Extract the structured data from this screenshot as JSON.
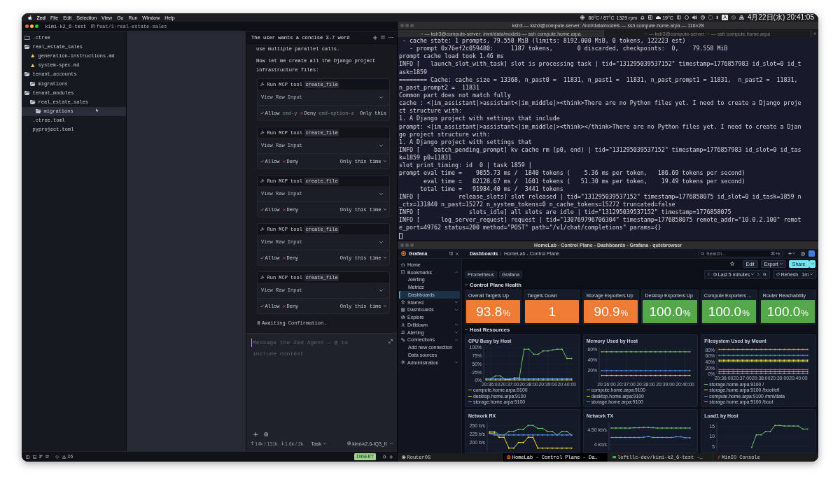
{
  "menu_bar": {
    "app_name": "Zed",
    "menus": [
      "File",
      "Edit",
      "Selection",
      "View",
      "Go",
      "Run",
      "Window",
      "Help"
    ],
    "sensor_readings": [
      "86°C / 87°C",
      "1329 rpm"
    ],
    "weather": "19°C",
    "input_source": "A",
    "clock": "4月22日(水) 20:41:05"
  },
  "zed": {
    "project": "kimi-k2_6-test",
    "branch": "feat/1-real-estate-sales",
    "project_panel": [
      {
        "label": ".ctree",
        "kind": "folder",
        "expanded": false,
        "selected": false
      },
      {
        "label": "real_estate_sales",
        "kind": "folder",
        "expanded": true,
        "selected": false,
        "children": [
          {
            "label": "generation-instructions.md",
            "kind": "doc",
            "selected": false
          },
          {
            "label": "system-spec.md",
            "kind": "doc",
            "selected": false
          }
        ]
      },
      {
        "label": "tenant_accounts",
        "kind": "folder",
        "expanded": true,
        "selected": false,
        "children": [
          {
            "label": "migrations",
            "kind": "folder",
            "expanded": true,
            "selected": false
          }
        ]
      },
      {
        "label": "tenant_modules",
        "kind": "folder",
        "expanded": true,
        "selected": false,
        "children": [
          {
            "label": "real_estate_sales",
            "kind": "folder",
            "expanded": true,
            "selected": false,
            "children": [
              {
                "label": "migrations",
                "kind": "folder",
                "expanded": true,
                "selected": true
              }
            ]
          }
        ]
      },
      {
        "label": ".ctree.toml",
        "kind": "file",
        "selected": false
      },
      {
        "label": "pyproject.toml",
        "kind": "file",
        "selected": false
      }
    ],
    "agent_panel": {
      "thread_title": "The user wants a concise 3-7 word",
      "messages": [
        "use multiple parallel calls.",
        "Now let me create all the Django project infrastructure files:"
      ],
      "tool_calls": [
        {
          "label": "Run MCP tool",
          "tool": "create_file",
          "raw_input": "View Raw Input",
          "allow": "Allow",
          "allow_shortcut": "cmd-y",
          "deny": "Deny",
          "deny_shortcut": "cmd-option-z",
          "scope": "Only this"
        },
        {
          "label": "Run MCP tool",
          "tool": "create_file",
          "raw_input": "View Raw Input",
          "allow": "Allow",
          "deny": "Deny",
          "scope": "Only this time"
        },
        {
          "label": "Run MCP tool",
          "tool": "create_file",
          "raw_input": "View Raw Input",
          "allow": "Allow",
          "deny": "Deny",
          "scope": "Only this time"
        },
        {
          "label": "Run MCP tool",
          "tool": "create_file",
          "raw_input": "View Raw Input",
          "allow": "Allow",
          "deny": "Deny",
          "scope": "Only this time"
        },
        {
          "label": "Run MCP tool",
          "tool": "create_file",
          "raw_input": "View Raw Input",
          "allow": "Allow",
          "deny": "Deny",
          "scope": "Only this time"
        }
      ],
      "status": "Awaiting Confirmation.",
      "input": {
        "placeholder": "Message the Zed Agent — @ to include context"
      },
      "tokens_sent": "14k / 131k",
      "tokens_received": "1.6k / 2k",
      "mode": "Task",
      "model": "kimi-k2.6-IQ3_K"
    },
    "status_bar": {
      "warnings": "36",
      "mode": "INSERT"
    }
  },
  "terminal": {
    "title": "ksh3 — ksh3@compute-server: /mnt/data/models — ssh compute.home.arpa — 116×28",
    "tabs": [
      {
        "label": "~ — ksh3@compute-server: /mnt/data/models — ssh compute.home.arpa",
        "selected": true
      },
      {
        "label": "~ — ksh3@compute-server: ~ — ssh compute.home.arpa",
        "selected": false
      }
    ],
    "lines": [
      " - cache state: 1 prompts, 79.558 MiB (limits: 8192.000 MiB, 0 tokens, 122223 est)",
      "   - prompt 0x76ef2c059480:     1187 tokens,       0 discarded, checkpoints:  0,    79.558 MiB",
      "prompt cache load took 1.46 ms",
      "INFO [   launch_slot_with_task] slot is processing task | tid=\"131295039537152\" timestamp=1776857983 id_slot=0 id_t",
      "ask=1859",
      "======== Cache: cache_size = 13368, n_past0 =  11831, n_past1 =  11831, n_past_prompt1 = 11831,  n_past2 =  11831,",
      "n_past_prompt2 =  11831",
      "Common part does not match fully",
      "cache : <|im_assistant|>assistant<|im_middle|><think>There are no Python files yet. I need to create a Django proje",
      "ct structure with:",
      "1. A Django project with settings that include",
      "prompt: <|im_assistant|>assistant<|im_middle|><think></think>There are no Python files yet. I need to create a Djan",
      "go project structure with:",
      "1. A Django project with settings that",
      "INFO [    batch_pending_prompt] kv cache rm [p0, end) | tid=\"131295039537152\" timestamp=1776857983 id_slot=0 id_tas",
      "k=1859 p0=11831",
      "slot print_timing: id  0 | task 1859 |",
      "prompt eval time =    9855.73 ms /  1840 tokens (    5.36 ms per token,   186.69 tokens per second)",
      "       eval time =   82128.67 ms /  1601 tokens (   51.30 ms per token,    19.49 tokens per second)",
      "      total time =   91984.40 ms /  3441 tokens",
      "INFO [           release_slots] slot released | tid=\"131295039537152\" timestamp=1776858075 id_slot=0 id_task=1859 n",
      "_ctx=131840 n_past=15272 n_system_tokens=0 n_cache_tokens=15272 truncated=false",
      "INFO [              slots_idle] all slots are idle | tid=\"131295039537152\" timestamp=1776858075",
      "INFO [      log_server_request] request | tid=\"130769796706304\" timestamp=1776858075 remote_addr=\"10.0.2.100\" remot",
      "e_port=49762 status=200 method=\"POST\" path=\"/v1/chat/completions\" params={}"
    ]
  },
  "browser": {
    "title": "HomeLab - Control Plane - Dashboards - Grafana - qutebrowser",
    "grafana": {
      "brand": "Grafana",
      "breadcrumbs": [
        "Dashboards",
        "HomeLab - Control Plane"
      ],
      "search": {
        "placeholder": "Search...",
        "shortcut": "⌘+k"
      },
      "nav": [
        {
          "label": "Home",
          "kind": "home",
          "selected": false
        },
        {
          "label": "Bookmarks",
          "kind": "bookmark",
          "selected": false,
          "expanded": true,
          "children": [
            {
              "label": "Alerting",
              "selected": false
            },
            {
              "label": "Metrics",
              "selected": false
            },
            {
              "label": "Dashboards",
              "selected": true
            }
          ]
        },
        {
          "label": "Starred",
          "kind": "star",
          "selected": false,
          "expanded": false
        },
        {
          "label": "Dashboards",
          "kind": "apps",
          "selected": false,
          "expanded": false
        },
        {
          "label": "Explore",
          "kind": "compass",
          "selected": false
        },
        {
          "label": "Drilldown",
          "kind": "drilldown",
          "selected": false,
          "expanded": false
        },
        {
          "label": "Alerting",
          "kind": "bell",
          "selected": false,
          "expanded": false
        },
        {
          "label": "Connections",
          "kind": "link",
          "selected": false,
          "expanded": true,
          "children": [
            {
              "label": "Add new connection",
              "selected": false
            },
            {
              "label": "Data sources",
              "selected": false
            }
          ]
        },
        {
          "label": "Administration",
          "kind": "gear",
          "selected": false,
          "expanded": false
        }
      ],
      "toolbar": {
        "edit": "Edit",
        "export": "Export",
        "share": "Share"
      },
      "links": [
        "Prometheus",
        "Grafana"
      ],
      "time_range": "Last 5 minutes",
      "refresh": "Refresh",
      "refresh_interval": "1m",
      "rows": [
        {
          "title": "Control Plane Health",
          "expanded": true,
          "panels": [
            {
              "kind": "stat",
              "title": "Overall Targets Up",
              "value": "93.8",
              "unit": "%",
              "color": "#ef7b35"
            },
            {
              "kind": "stat",
              "title": "Targets Down",
              "value": "1",
              "color": "#ef7b35"
            },
            {
              "kind": "stat",
              "title": "Storage Exporters Up",
              "value": "90.9",
              "unit": "%",
              "color": "#ef7b35"
            },
            {
              "kind": "stat",
              "title": "Desktop Exporters Up",
              "value": "100.0",
              "unit": "%",
              "color": "#54a84a"
            },
            {
              "kind": "stat",
              "title": "Compute Exporters ...",
              "value": "100.0",
              "unit": "%",
              "color": "#54a84a"
            },
            {
              "kind": "stat",
              "title": "Router Reachability",
              "value": "100.0",
              "unit": "%",
              "color": "#54a84a"
            }
          ]
        },
        {
          "title": "Host Resources",
          "expanded": true,
          "panels": [
            {
              "kind": "timeseries",
              "chart_data": {
                "type": "line",
                "title": "CPU Busy by Host",
                "grid": true,
                "legend": "bottom",
                "categories": [
                  null,
                  "20:36:00",
                  null,
                  null,
                  null,
                  "20:37:00",
                  null,
                  null,
                  null,
                  "20:38:00",
                  null,
                  null,
                  null,
                  "20:39:00",
                  null,
                  null,
                  null,
                  "20:40:00",
                  null
                ],
                "ylim": [
                  0,
                  100
                ],
                "yticks": [
                  {
                    "value": 0,
                    "label": "0%"
                  },
                  {
                    "value": 25,
                    "label": "25%"
                  },
                  {
                    "value": 50,
                    "label": "50%"
                  },
                  {
                    "value": 75,
                    "label": "75%"
                  },
                  {
                    "value": 100,
                    "label": "100%"
                  }
                ],
                "series": [
                  {
                    "name": "compute.home.arpa:9100",
                    "color": "#73bf69",
                    "values": [
                      5,
                      5,
                      14,
                      14,
                      3,
                      3,
                      8,
                      8,
                      95,
                      95,
                      80,
                      80,
                      90,
                      90,
                      93,
                      95,
                      95,
                      67,
                      67
                    ]
                  },
                  {
                    "name": "desktop.home.arpa:9100",
                    "color": "#fade2a",
                    "values": [
                      2,
                      2,
                      2,
                      2,
                      2,
                      2,
                      2,
                      2,
                      2,
                      2,
                      2,
                      2,
                      2,
                      2,
                      2,
                      2,
                      2,
                      2,
                      2
                    ]
                  },
                  {
                    "name": "storage.home.arpa:9100",
                    "color": "#5794f2",
                    "values": [
                      5,
                      5,
                      5,
                      5,
                      5,
                      5,
                      5,
                      5,
                      5,
                      5,
                      5,
                      5,
                      5,
                      5,
                      5,
                      5,
                      5,
                      5,
                      5
                    ]
                  }
                ]
              }
            },
            {
              "kind": "timeseries",
              "chart_data": {
                "type": "line",
                "title": "Memory Used by Host",
                "grid": true,
                "legend": "bottom",
                "categories": [
                  null,
                  "20:36:00",
                  null,
                  null,
                  null,
                  "20:37:00",
                  null,
                  null,
                  null,
                  "20:38:00",
                  null,
                  null,
                  null,
                  "20:39:00",
                  null,
                  null,
                  null,
                  "20:40:00",
                  null
                ],
                "ylim": [
                  0,
                  64
                ],
                "yticks": [
                  {
                    "value": 20,
                    "label": "20%"
                  },
                  {
                    "value": 40,
                    "label": "40%"
                  },
                  {
                    "value": 60,
                    "label": "60%"
                  }
                ],
                "series": [
                  {
                    "name": "compute.home.arpa:9100",
                    "color": "#73bf69",
                    "values": [
                      56,
                      56,
                      56,
                      56,
                      56,
                      56,
                      56,
                      56,
                      56,
                      56,
                      56,
                      56,
                      56,
                      56,
                      56,
                      56,
                      56,
                      56,
                      56
                    ]
                  },
                  {
                    "name": "desktop.home.arpa:9100",
                    "color": "#fade2a",
                    "values": [
                      10,
                      10,
                      10,
                      10,
                      10,
                      10,
                      10,
                      10,
                      10,
                      10,
                      10,
                      10,
                      10,
                      10,
                      10,
                      10,
                      10,
                      10,
                      10
                    ]
                  },
                  {
                    "name": "storage.home.arpa:9100",
                    "color": "#5794f2",
                    "values": [
                      19,
                      19,
                      19,
                      19,
                      19,
                      19,
                      19,
                      19,
                      19,
                      19,
                      19,
                      19,
                      19,
                      19,
                      19,
                      19,
                      19,
                      19,
                      19
                    ]
                  }
                ]
              }
            },
            {
              "kind": "timeseries",
              "chart_data": {
                "type": "line",
                "title": "Filesystem Used by Mount",
                "grid": true,
                "legend": "bottom",
                "categories": [
                  null,
                  "20:36:00",
                  null,
                  null,
                  null,
                  "20:37:00",
                  null,
                  null,
                  null,
                  "20:38:00",
                  null,
                  null,
                  null,
                  "20:39:00",
                  null,
                  null,
                  null,
                  "20:40:00",
                  null,
                  null
                ],
                "ylim": [
                  0,
                  88
                ],
                "yticks": [
                  {
                    "value": 0,
                    "label": "0%"
                  },
                  {
                    "value": 20,
                    "label": "20%"
                  },
                  {
                    "value": 40,
                    "label": "40%"
                  },
                  {
                    "value": 60,
                    "label": "60%"
                  },
                  {
                    "value": 80,
                    "label": "80%"
                  }
                ],
                "series": [
                  {
                    "name": "storage.home.arpa:9100 /",
                    "color": "#73bf69",
                    "values": [
                      42,
                      42,
                      42,
                      42,
                      42,
                      42,
                      42,
                      42,
                      42,
                      42,
                      42,
                      42,
                      42,
                      42,
                      42,
                      42,
                      42,
                      42,
                      42,
                      42
                    ]
                  },
                  {
                    "name": "storage.home.arpa:9100 /boot/efi",
                    "color": "#fade2a",
                    "values": [
                      46,
                      46,
                      46,
                      46,
                      46,
                      46,
                      46,
                      46,
                      46,
                      46,
                      46,
                      46,
                      46,
                      46,
                      46,
                      46,
                      46,
                      46,
                      46,
                      46
                    ]
                  },
                  {
                    "name": "compute.home.arpa:9100 /mnt/data",
                    "color": "#5794f2",
                    "values": [
                      62,
                      62,
                      62,
                      62,
                      62,
                      62,
                      62,
                      62,
                      62,
                      62,
                      62,
                      62,
                      62,
                      62,
                      62,
                      62,
                      62,
                      62,
                      62,
                      62
                    ]
                  },
                  {
                    "name": "storage.home.arpa:9100 /boot",
                    "color": "#ff9830",
                    "values": [
                      82,
                      82,
                      82,
                      82,
                      82,
                      82,
                      82,
                      82,
                      82,
                      82,
                      82,
                      82,
                      82,
                      82,
                      82,
                      82,
                      82,
                      82,
                      82,
                      82
                    ]
                  },
                  {
                    "color": "#f2495c",
                    "values": [
                      15,
                      15,
                      15,
                      15,
                      15,
                      15,
                      15,
                      15,
                      15,
                      15,
                      15,
                      15,
                      15,
                      15,
                      15,
                      15,
                      15,
                      15,
                      15,
                      15
                    ]
                  },
                  {
                    "color": "#8ab8ff",
                    "values": [
                      8,
                      8,
                      8,
                      8,
                      8,
                      8,
                      8,
                      8,
                      8,
                      8,
                      8,
                      8,
                      8,
                      8,
                      8,
                      8,
                      8,
                      8,
                      8,
                      8
                    ]
                  },
                  {
                    "color": "#b877d9",
                    "values": [
                      2,
                      2,
                      2,
                      2,
                      2,
                      2,
                      2,
                      2,
                      2,
                      2,
                      2,
                      2,
                      2,
                      2,
                      2,
                      2,
                      2,
                      2,
                      2,
                      2
                    ]
                  }
                ]
              }
            },
            {
              "kind": "timeseries",
              "chart_data": {
                "type": "line",
                "title": "Network RX",
                "grid": true,
                "categories": [
                  null,
                  null,
                  null,
                  null,
                  null,
                  null,
                  null,
                  null,
                  null,
                  null,
                  null,
                  null,
                  null,
                  null,
                  null,
                  null,
                  null,
                  null
                ],
                "ylim": [
                  175,
                  260
                ],
                "yticks": [
                  {
                    "value": 200,
                    "label": "200 b/s"
                  },
                  {
                    "value": 225,
                    "label": "225 b/s"
                  },
                  {
                    "value": 250,
                    "label": "250 b/s"
                  }
                ],
                "series": [
                  {
                    "color": "#73bf69",
                    "values": [
                      233,
                      233,
                      222,
                      222,
                      233,
                      233,
                      239,
                      239,
                      251,
                      251,
                      242,
                      242,
                      233,
                      233,
                      222,
                      233,
                      233,
                      222
                    ]
                  },
                  {
                    "color": "#fade2a",
                    "values": [
                      228,
                      228,
                      215,
                      215,
                      182,
                      182,
                      199,
                      199,
                      215,
                      215,
                      182,
                      182,
                      182,
                      182,
                      182,
                      182,
                      182,
                      182
                    ]
                  },
                  {
                    "color": "#5794f2",
                    "values": [
                      226,
                      222,
                      222,
                      222,
                      222,
                      222,
                      222,
                      222,
                      222,
                      222,
                      222,
                      222,
                      222,
                      222,
                      222,
                      222,
                      222,
                      222
                    ]
                  }
                ]
              }
            },
            {
              "kind": "timeseries",
              "chart_data": {
                "type": "line",
                "title": "Network TX",
                "grid": true,
                "categories": [
                  null,
                  null,
                  null,
                  null,
                  null,
                  null,
                  null,
                  null,
                  null,
                  null,
                  null,
                  null,
                  null,
                  null,
                  null,
                  null,
                  null,
                  null
                ],
                "ylim": [
                  3.8,
                  4.75
                ],
                "yticks": [
                  {
                    "value": 4,
                    "label": "4 kb/s"
                  },
                  {
                    "value": 4.5,
                    "label": "4.50 kb/s"
                  }
                ],
                "series": [
                  {
                    "color": "#73bf69",
                    "values": [
                      4.56,
                      4.56,
                      4.56,
                      4.56,
                      4.56,
                      4.57,
                      4.57,
                      4.58,
                      4.58,
                      4.57,
                      4.56,
                      4.56,
                      4.56,
                      4.56,
                      4.56,
                      4.56,
                      4.56,
                      4.56
                    ]
                  },
                  {
                    "color": "#5794f2",
                    "values": [
                      4.24,
                      4.24,
                      4.24,
                      4.24,
                      4.24,
                      4.24,
                      4.24,
                      4.25,
                      4.27,
                      4.24,
                      4.24,
                      4.24,
                      4.24,
                      4.24,
                      4.26,
                      4.26,
                      4.23,
                      4.23
                    ]
                  }
                ]
              }
            },
            {
              "kind": "timeseries",
              "chart_data": {
                "type": "line",
                "title": "Load1 by Host",
                "grid": true,
                "categories": [
                  null,
                  null,
                  null,
                  null,
                  null,
                  null,
                  null,
                  null,
                  null,
                  null,
                  null,
                  null,
                  null,
                  null,
                  null,
                  null,
                  null,
                  null,
                  null,
                  null
                ],
                "ylim": [
                  3,
                  17
                ],
                "yticks": [
                  {
                    "value": 5,
                    "label": "5"
                  },
                  {
                    "value": 10,
                    "label": "10"
                  },
                  {
                    "value": 15,
                    "label": "15"
                  }
                ],
                "series": [
                  {
                    "color": "#73bf69",
                    "values": [
                      null,
                      null,
                      null,
                      null,
                      null,
                      null,
                      null,
                      4.6,
                      10.8,
                      10.8,
                      12.5,
                      12.5,
                      15.5,
                      15.5,
                      15.2,
                      15.2,
                      15.2,
                      15.2,
                      13.7,
                      13.7
                    ]
                  }
                ]
              }
            }
          ]
        }
      ]
    },
    "tabs": [
      {
        "label": "RouterOS",
        "kind": "router",
        "selected": false
      },
      {
        "label": "HomeLab - Control Plane - Da…",
        "kind": "dashboard",
        "selected": true
      },
      {
        "label": "loftllc-dev/kimi-k2_6-test -…",
        "kind": "repository",
        "selected": false
      },
      {
        "label": "MinIO Console",
        "kind": "storage",
        "selected": false
      }
    ]
  }
}
